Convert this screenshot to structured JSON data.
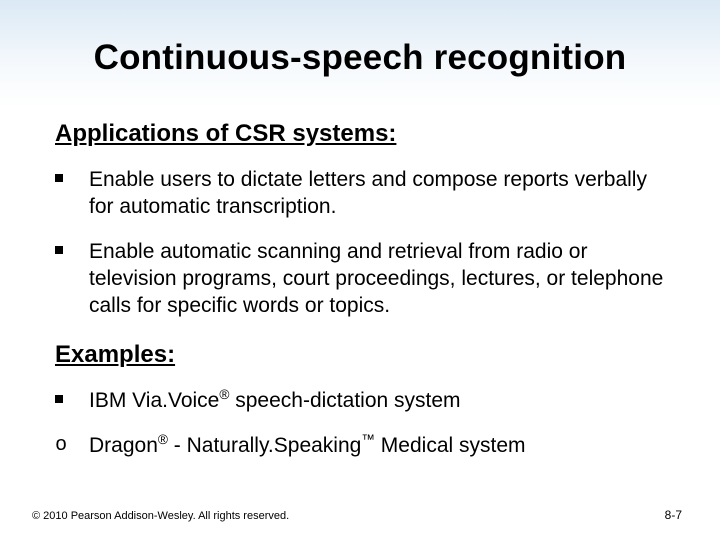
{
  "title": "Continuous-speech recognition",
  "section1_heading": "Applications of CSR systems:",
  "bullets1": [
    "Enable users to dictate letters and compose reports verbally for automatic transcription.",
    "Enable automatic scanning and retrieval from radio or television programs, court proceedings, lectures, or telephone calls for specific words or topics."
  ],
  "section2_heading": "Examples:",
  "example1_pre": "IBM Via.Voice",
  "example1_sup": "®",
  "example1_post": " speech-dictation system",
  "example2_a": "Dragon",
  "example2_sup1": "®",
  "example2_mid": "  -  Naturally.Speaking",
  "example2_sup2": "™",
  "example2_post": " Medical system",
  "footer_left": "© 2010 Pearson Addison-Wesley. All rights reserved.",
  "footer_right": "8-7"
}
